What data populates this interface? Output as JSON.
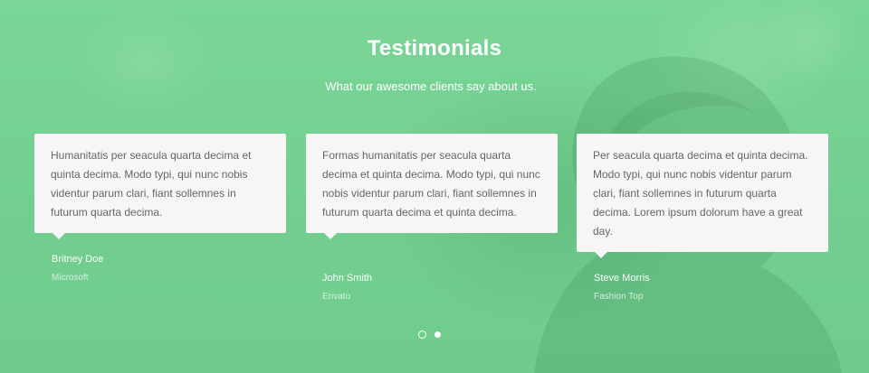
{
  "section": {
    "title": "Testimonials",
    "subtitle": "What our awesome clients say about us."
  },
  "testimonials": [
    {
      "quote": "Humanitatis per seacula quarta decima et quinta decima. Modo typi, qui nunc nobis videntur parum clari, fiant sollemnes in futurum quarta decima.",
      "author": "Britney Doe",
      "company": "Microsoft"
    },
    {
      "quote": "Formas humanitatis per seacula quarta decima et quinta decima. Modo typi, qui nunc nobis videntur parum clari, fiant sollemnes in futurum quarta decima et quinta decima.",
      "author": "John Smith",
      "company": "Envato"
    },
    {
      "quote": "Per seacula quarta decima et quinta decima. Modo typi, qui nunc nobis videntur parum clari, fiant sollemnes in futurum quarta decima. Lorem ipsum dolorum have a great day.",
      "author": "Steve Morris",
      "company": "Fashion Top"
    }
  ],
  "pagination": {
    "pages": 2,
    "active_page": 1
  },
  "colors": {
    "overlay_green": "#74d193",
    "card_background": "#f6f6f6",
    "card_text": "#666666",
    "heading_text": "#ffffff"
  }
}
